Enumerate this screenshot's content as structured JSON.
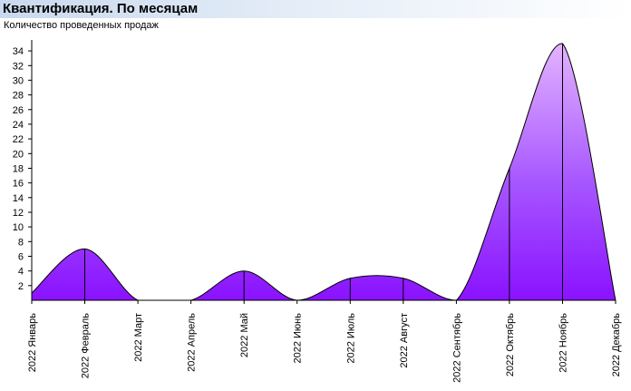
{
  "header": {
    "title": "Квантификация. По месяцам",
    "subtitle": "Количество проведенных продаж"
  },
  "colors": {
    "fill_top": "#e2b3ff",
    "fill_mid": "#a655ff",
    "fill_bottom": "#8a12ff",
    "outline": "#000000",
    "title_bar": "#c9d9ee"
  },
  "chart_data": {
    "type": "area",
    "title": "Квантификация. По месяцам",
    "ylabel": "Количество проведенных продаж",
    "xlabel": "",
    "categories": [
      "2022 Январь",
      "2022 Февраль",
      "2022 Март",
      "2022 Апрель",
      "2022 Май",
      "2022 Июнь",
      "2022 Июль",
      "2022 Август",
      "2022 Сентябрь",
      "2022 Октябрь",
      "2022 Ноябрь",
      "2022 Декабрь"
    ],
    "values": [
      1,
      7,
      0,
      0,
      4,
      0,
      3,
      3,
      0,
      18,
      35,
      0
    ],
    "ylim": [
      0,
      35
    ],
    "yticks": [
      2,
      4,
      6,
      8,
      10,
      12,
      14,
      16,
      18,
      20,
      22,
      24,
      26,
      28,
      30,
      32,
      34
    ],
    "smooth": true,
    "grid": false,
    "legend": "none"
  }
}
